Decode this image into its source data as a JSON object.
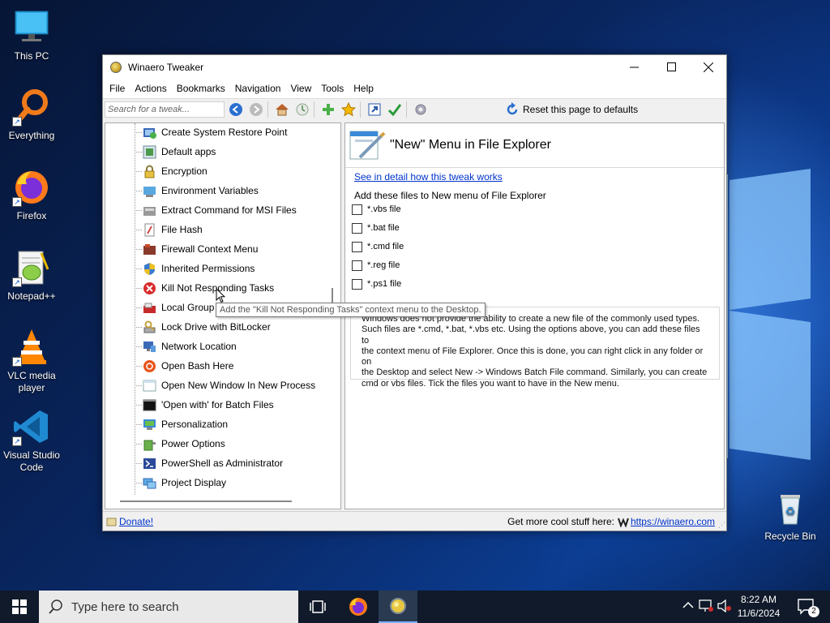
{
  "desktop": {
    "icons": [
      {
        "label": "This PC",
        "icon": "computer-icon"
      },
      {
        "label": "Everything",
        "icon": "everything-icon"
      },
      {
        "label": "Firefox",
        "icon": "firefox-icon"
      },
      {
        "label": "Notepad++",
        "icon": "notepadpp-icon"
      },
      {
        "label": "VLC media player",
        "icon": "vlc-icon"
      },
      {
        "label": "Visual Studio Code",
        "icon": "vscode-icon"
      },
      {
        "label": "Recycle Bin",
        "icon": "recycle-bin-icon"
      }
    ]
  },
  "window": {
    "title": "Winaero Tweaker",
    "menu": [
      "File",
      "Actions",
      "Bookmarks",
      "Navigation",
      "View",
      "Tools",
      "Help"
    ],
    "toolbar": {
      "search_placeholder": "Search for a tweak...",
      "reset_label": "Reset this page to defaults"
    }
  },
  "tree": {
    "items": [
      {
        "label": "Create System Restore Point",
        "icon": "restore-point-icon"
      },
      {
        "label": "Default apps",
        "icon": "default-apps-icon"
      },
      {
        "label": "Encryption",
        "icon": "lock-icon"
      },
      {
        "label": "Environment Variables",
        "icon": "environment-icon"
      },
      {
        "label": "Extract Command for MSI Files",
        "icon": "msi-icon"
      },
      {
        "label": "File Hash",
        "icon": "file-hash-icon"
      },
      {
        "label": "Firewall Context Menu",
        "icon": "firewall-icon"
      },
      {
        "label": "Inherited Permissions",
        "icon": "shield-icon"
      },
      {
        "label": "Kill Not Responding Tasks",
        "icon": "kill-task-icon"
      },
      {
        "label": "Local Group Policy Editor",
        "icon": "group-policy-icon"
      },
      {
        "label": "Lock Drive with BitLocker",
        "icon": "bitlocker-icon"
      },
      {
        "label": "Network Location",
        "icon": "network-icon"
      },
      {
        "label": "Open Bash Here",
        "icon": "ubuntu-icon"
      },
      {
        "label": "Open New Window In New Process",
        "icon": "window-icon"
      },
      {
        "label": "'Open with' for Batch Files",
        "icon": "console-icon"
      },
      {
        "label": "Personalization",
        "icon": "personalization-icon"
      },
      {
        "label": "Power Options",
        "icon": "power-icon"
      },
      {
        "label": "PowerShell as Administrator",
        "icon": "powershell-icon"
      },
      {
        "label": "Project Display",
        "icon": "project-display-icon"
      }
    ]
  },
  "tooltip": "Add the \"Kill Not Responding Tasks\" context menu to the Desktop.",
  "page": {
    "title": "\"New\" Menu in File Explorer",
    "detail_link": "See in detail how this tweak works",
    "files_label": "Add these files to New menu of File Explorer",
    "options": [
      {
        "label": "*.vbs file",
        "checked": false
      },
      {
        "label": "*.bat file",
        "checked": false
      },
      {
        "label": "*.cmd file",
        "checked": false
      },
      {
        "label": "*.reg file",
        "checked": false
      },
      {
        "label": "*.ps1 file",
        "checked": false
      }
    ],
    "description_lines": [
      "Windows does not provide the ability to create a new file of the commonly used types.",
      "Such files are *.cmd, *.bat, *.vbs etc. Using the options above, you can add these files to",
      "the context menu of File Explorer. Once this is done, you can right click in any folder or on",
      "the Desktop and select New -> Windows Batch File command. Similarly, you can create",
      "cmd or vbs files. Tick the files you want to have in the New menu."
    ]
  },
  "statusbar": {
    "donate": "Donate!",
    "more": "Get more cool stuff here:",
    "site": "https://winaero.com"
  },
  "taskbar": {
    "search_placeholder": "Type here to search",
    "time": "8:22 AM",
    "date": "11/6/2024",
    "notification_count": "2"
  },
  "colors": {
    "accent": "#0078d7",
    "link": "#0033cc",
    "taskbar": "#101a2a"
  }
}
